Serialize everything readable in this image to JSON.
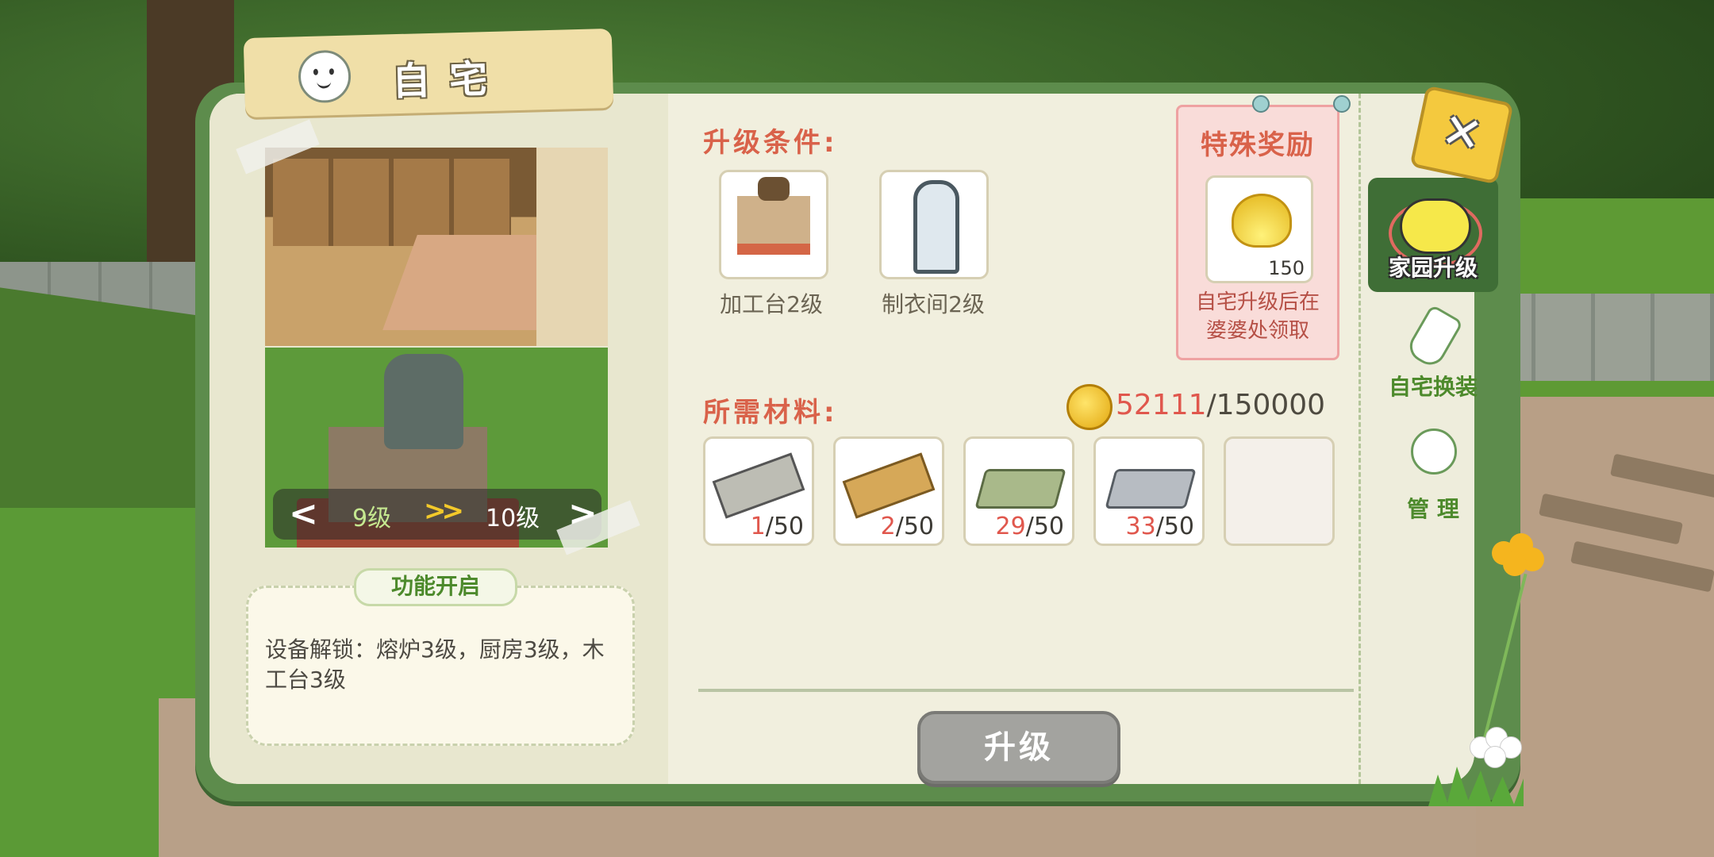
{
  "title": "自宅",
  "level": {
    "current": "9级",
    "next": "10级",
    "prev_arrow": "<",
    "next_arrow": ">",
    "separator": ">>"
  },
  "function_unlock": {
    "title": "功能开启",
    "text": "设备解锁：熔炉3级，厨房3级，木工台3级"
  },
  "upgrade_conditions": {
    "heading": "升级条件:",
    "items": [
      {
        "label": "加工台2级",
        "icon": "workbench-icon"
      },
      {
        "label": "制衣间2级",
        "icon": "mirror-icon"
      }
    ]
  },
  "special_reward": {
    "title": "特殊奖励",
    "quantity": "150",
    "icon": "golden-shell-icon",
    "desc_line1": "自宅升级后在",
    "desc_line2": "婆婆处领取"
  },
  "materials": {
    "heading": "所需材料:",
    "coin": {
      "have": "52111",
      "need": "/150000",
      "icon": "gold-coin-icon"
    },
    "items": [
      {
        "icon": "stone-wood-icon",
        "have": "1",
        "need": "/50"
      },
      {
        "icon": "wood-plank-icon",
        "have": "2",
        "need": "/50"
      },
      {
        "icon": "green-ingot-icon",
        "have": "29",
        "need": "/50"
      },
      {
        "icon": "iron-ingot-icon",
        "have": "33",
        "need": "/50"
      }
    ]
  },
  "upgrade_button": "升级",
  "side_tabs": [
    {
      "label": "家园升级",
      "active": true
    },
    {
      "label": "自宅换装",
      "active": false
    },
    {
      "label": "管 理",
      "active": false
    }
  ],
  "close_button": "✕",
  "colors": {
    "panel_border": "#5d8c4c",
    "heading": "#d9624a",
    "shortage": "#e0574d",
    "accent_green": "#4d8a2c"
  }
}
